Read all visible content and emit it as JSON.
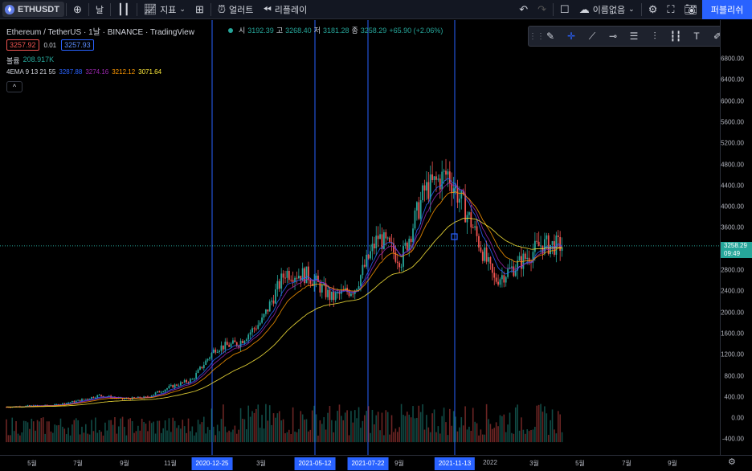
{
  "topbar": {
    "symbol": "ETHUSDT",
    "interval": "날",
    "indicators_label": "지표",
    "alert_label": "얼러트",
    "replay_label": "리플레이",
    "layout_name": "이름없음",
    "publish_label": "퍼블리쉬"
  },
  "legend": {
    "title": "Ethereum / TetherUS · 1날 · BINANCE · TradingView",
    "bid": "3257.92",
    "spread": "0.01",
    "ask": "3257.93",
    "ohlc": {
      "open_label": "시",
      "open": "3192.39",
      "high_label": "고",
      "high": "3268.40",
      "low_label": "저",
      "low": "3181.28",
      "close_label": "종",
      "close": "3258.29",
      "change": "+65.90 (+2.06%)"
    },
    "volume_label": "볼륨",
    "volume_value": "208.917K",
    "ema_label": "4EMA 9 13 21 55",
    "ema_values": [
      "3287.88",
      "3274.16",
      "3212.12",
      "3071.64"
    ],
    "ema_colors": [
      "#2962ff",
      "#9c27b0",
      "#ff9800",
      "#ffeb3b"
    ],
    "collapse_glyph": "^"
  },
  "price_axis": {
    "ticks": [
      "6800.00",
      "6400.00",
      "6000.00",
      "5600.00",
      "5200.00",
      "4800.00",
      "4400.00",
      "4000.00",
      "3600.00",
      "3200.00",
      "2800.00",
      "2400.00",
      "2000.00",
      "1600.00",
      "1200.00",
      "800.00",
      "400.00",
      "0.00",
      "-400.00"
    ],
    "tick_values": [
      6800,
      6400,
      6000,
      5600,
      5200,
      4800,
      4400,
      4000,
      3600,
      3200,
      2800,
      2400,
      2000,
      1600,
      1200,
      800,
      400,
      0,
      -400
    ],
    "current_price": "3258.29",
    "countdown": "09:49"
  },
  "time_axis": {
    "ticks": [
      "5월",
      "7월",
      "9월",
      "11월",
      "3월",
      "9월",
      "2022",
      "3월",
      "5월",
      "7월",
      "9월"
    ],
    "highlighted": [
      "2020-12-25",
      "2021-05-12",
      "2021-07-22",
      "2021-11-13"
    ]
  },
  "colors": {
    "up": "#26a69a",
    "down": "#ef5350",
    "vline": "#2962ff",
    "accent": "#2962ff"
  },
  "icons": [
    "plus-circle-icon",
    "candles-icon",
    "indicators-icon",
    "templates-icon",
    "alarm-icon",
    "replay-icon",
    "undo-icon",
    "redo-icon",
    "layout-square-icon",
    "cloud-icon",
    "settings-icon",
    "fullscreen-icon",
    "camera-icon"
  ],
  "draw_tools": [
    "brush-icon",
    "crosshair-icon",
    "trendline-icon",
    "horizontal-ray-icon",
    "fib-icon",
    "long-position-icon",
    "forecast-icon",
    "text-icon",
    "pen-icon",
    "rectangle-icon"
  ],
  "chart_data": {
    "type": "candlestick",
    "symbol": "ETHUSDT",
    "interval": "1D",
    "x": [
      "2020-04",
      "2020-05",
      "2020-06",
      "2020-07",
      "2020-08",
      "2020-09",
      "2020-10",
      "2020-11",
      "2020-12",
      "2021-01",
      "2021-02",
      "2021-03",
      "2021-04",
      "2021-05",
      "2021-06",
      "2021-07",
      "2021-08",
      "2021-09",
      "2021-10",
      "2021-11",
      "2021-12",
      "2022-01",
      "2022-02",
      "2022-03",
      "2022-04"
    ],
    "close": [
      210,
      230,
      240,
      320,
      430,
      360,
      390,
      580,
      730,
      1320,
      1420,
      1840,
      2760,
      2700,
      2270,
      2460,
      3430,
      3000,
      4300,
      4630,
      3700,
      2600,
      2900,
      3280,
      3258
    ],
    "ylim": [
      -400,
      6800
    ],
    "highlighted_dates": [
      "2020-12-25",
      "2021-05-12",
      "2021-07-22",
      "2021-11-13"
    ]
  }
}
